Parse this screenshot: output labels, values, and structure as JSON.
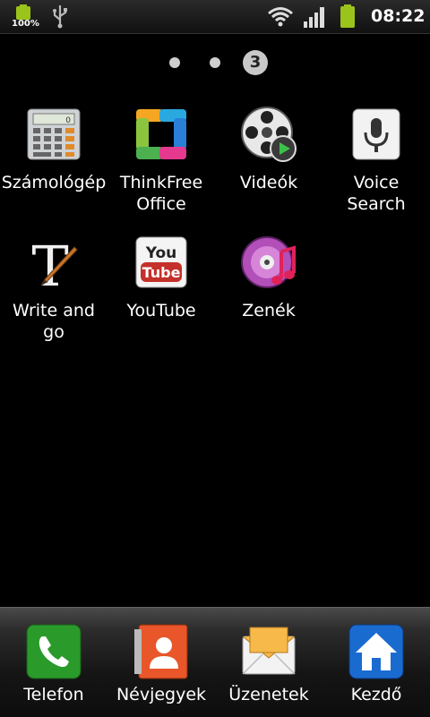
{
  "status_bar": {
    "battery_percent": "100%",
    "time": "08:22",
    "icons": [
      "battery-icon",
      "usb-icon",
      "wifi-icon",
      "signal-icon",
      "battery-icon"
    ]
  },
  "pager": {
    "current_page": "3",
    "pages_total": 3
  },
  "apps": [
    {
      "label": "Számológép",
      "icon": "calculator-icon"
    },
    {
      "label": "ThinkFree\nOffice",
      "icon": "thinkfree-office-icon"
    },
    {
      "label": "Videók",
      "icon": "video-reel-icon"
    },
    {
      "label": "Voice\nSearch",
      "icon": "microphone-icon"
    },
    {
      "label": "Write and\ngo",
      "icon": "write-and-go-icon"
    },
    {
      "label": "YouTube",
      "icon": "youtube-icon"
    },
    {
      "label": "Zenék",
      "icon": "music-disc-icon"
    }
  ],
  "dock": [
    {
      "label": "Telefon",
      "icon": "phone-icon"
    },
    {
      "label": "Névjegyek",
      "icon": "contacts-icon"
    },
    {
      "label": "Üzenetek",
      "icon": "envelope-icon"
    },
    {
      "label": "Kezdő",
      "icon": "home-icon"
    }
  ],
  "colors": {
    "background": "#000000",
    "battery_green": "#9ac31c",
    "phone_green": "#2a9a2a",
    "home_blue": "#1a6bd0",
    "contacts_orange": "#e8562a"
  }
}
